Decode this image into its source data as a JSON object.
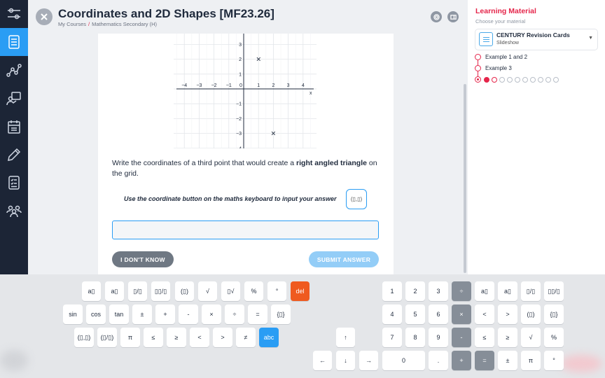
{
  "header": {
    "title": "Coordinates and 2D Shapes [MF23.26]",
    "breadcrumb_1": "My Courses",
    "breadcrumb_sep": "/",
    "breadcrumb_2": "Mathematics Secondary (H)"
  },
  "sidebar": {
    "items": [
      {
        "icon": "sliders-icon"
      },
      {
        "icon": "list-icon",
        "active": true
      },
      {
        "icon": "network-icon"
      },
      {
        "icon": "teacher-board-icon"
      },
      {
        "icon": "calendar-icon"
      },
      {
        "icon": "pencil-icon"
      },
      {
        "icon": "checklist-icon"
      },
      {
        "icon": "group-icon"
      }
    ]
  },
  "graph": {
    "x_ticks": [
      "−4",
      "−3",
      "−2",
      "−1",
      "0",
      "1",
      "2",
      "3",
      "4"
    ],
    "y_ticks": [
      "3",
      "2",
      "1",
      "−1",
      "−2",
      "−3",
      "−4"
    ],
    "x_axis_label": "x",
    "points": [
      {
        "x": 1,
        "y": 2,
        "marker": "×"
      },
      {
        "x": 2,
        "y": -3,
        "marker": "×"
      }
    ]
  },
  "question": {
    "text_before": "Write the coordinates of a third point that would create a ",
    "text_bold": "right angled triangle",
    "text_after": " on the grid.",
    "hint": "Use the coordinate button on the maths keyboard to input your answer",
    "coord_chip": "(▯,▯)",
    "answer_value": "",
    "dont_know_label": "I DON'T KNOW",
    "submit_label": "SUBMIT ANSWER"
  },
  "right_panel": {
    "title": "Learning Material",
    "subtitle": "Choose your material",
    "material_name": "CENTURY Revision Cards",
    "material_type": "Slideshow",
    "examples": [
      "Example 1 and 2",
      "Example 3"
    ],
    "steps_total": 11,
    "steps_done": 1
  },
  "keyboard": {
    "left_row1": [
      "a▯",
      "a▯",
      "▯/▯",
      "▯▯/▯",
      "(▯)",
      "√",
      "▯√",
      "%",
      "°",
      "del"
    ],
    "left_row2": [
      "sin",
      "cos",
      "tan",
      "±",
      "+",
      "-",
      "×",
      "÷",
      "=",
      "{▯}"
    ],
    "left_row3": [
      "(▯,▯)",
      "(▯/▯)",
      "π",
      "≤",
      "≥",
      "<",
      ">",
      "≠",
      "abc"
    ],
    "arrows": [
      "↑",
      "←",
      "↓",
      "→"
    ],
    "numpad": [
      "1",
      "2",
      "3",
      "÷",
      "4",
      "5",
      "6",
      "×",
      "7",
      "8",
      "9",
      "-",
      "0",
      ".",
      "+",
      "="
    ],
    "right_row1": [
      "a▯",
      "a▯",
      "▯/▯",
      "▯▯/▯"
    ],
    "right_row2": [
      "<",
      ">",
      "(▯)",
      "{▯}"
    ],
    "right_row3": [
      "≤",
      "≥",
      "√",
      "%"
    ],
    "right_row4": [
      "±",
      "π",
      "°"
    ]
  },
  "colors": {
    "accent_blue": "#2a9df4",
    "accent_red": "#e5254a",
    "del_orange": "#ef5a1f",
    "sidebar_dark": "#1c2536"
  }
}
